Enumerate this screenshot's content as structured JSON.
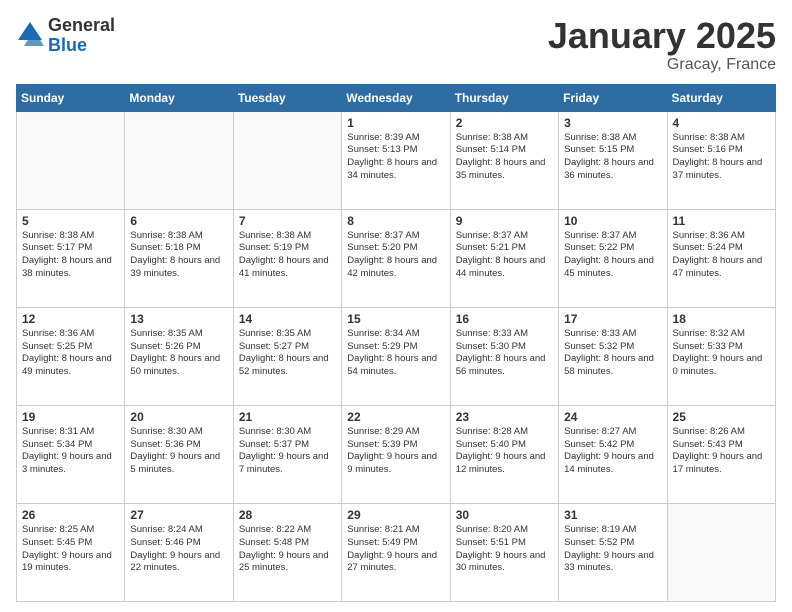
{
  "logo": {
    "general": "General",
    "blue": "Blue"
  },
  "header": {
    "title": "January 2025",
    "subtitle": "Gracay, France"
  },
  "days_of_week": [
    "Sunday",
    "Monday",
    "Tuesday",
    "Wednesday",
    "Thursday",
    "Friday",
    "Saturday"
  ],
  "weeks": [
    [
      {
        "day": "",
        "sunrise": "",
        "sunset": "",
        "daylight": ""
      },
      {
        "day": "",
        "sunrise": "",
        "sunset": "",
        "daylight": ""
      },
      {
        "day": "",
        "sunrise": "",
        "sunset": "",
        "daylight": ""
      },
      {
        "day": "1",
        "sunrise": "Sunrise: 8:39 AM",
        "sunset": "Sunset: 5:13 PM",
        "daylight": "Daylight: 8 hours and 34 minutes."
      },
      {
        "day": "2",
        "sunrise": "Sunrise: 8:38 AM",
        "sunset": "Sunset: 5:14 PM",
        "daylight": "Daylight: 8 hours and 35 minutes."
      },
      {
        "day": "3",
        "sunrise": "Sunrise: 8:38 AM",
        "sunset": "Sunset: 5:15 PM",
        "daylight": "Daylight: 8 hours and 36 minutes."
      },
      {
        "day": "4",
        "sunrise": "Sunrise: 8:38 AM",
        "sunset": "Sunset: 5:16 PM",
        "daylight": "Daylight: 8 hours and 37 minutes."
      }
    ],
    [
      {
        "day": "5",
        "sunrise": "Sunrise: 8:38 AM",
        "sunset": "Sunset: 5:17 PM",
        "daylight": "Daylight: 8 hours and 38 minutes."
      },
      {
        "day": "6",
        "sunrise": "Sunrise: 8:38 AM",
        "sunset": "Sunset: 5:18 PM",
        "daylight": "Daylight: 8 hours and 39 minutes."
      },
      {
        "day": "7",
        "sunrise": "Sunrise: 8:38 AM",
        "sunset": "Sunset: 5:19 PM",
        "daylight": "Daylight: 8 hours and 41 minutes."
      },
      {
        "day": "8",
        "sunrise": "Sunrise: 8:37 AM",
        "sunset": "Sunset: 5:20 PM",
        "daylight": "Daylight: 8 hours and 42 minutes."
      },
      {
        "day": "9",
        "sunrise": "Sunrise: 8:37 AM",
        "sunset": "Sunset: 5:21 PM",
        "daylight": "Daylight: 8 hours and 44 minutes."
      },
      {
        "day": "10",
        "sunrise": "Sunrise: 8:37 AM",
        "sunset": "Sunset: 5:22 PM",
        "daylight": "Daylight: 8 hours and 45 minutes."
      },
      {
        "day": "11",
        "sunrise": "Sunrise: 8:36 AM",
        "sunset": "Sunset: 5:24 PM",
        "daylight": "Daylight: 8 hours and 47 minutes."
      }
    ],
    [
      {
        "day": "12",
        "sunrise": "Sunrise: 8:36 AM",
        "sunset": "Sunset: 5:25 PM",
        "daylight": "Daylight: 8 hours and 49 minutes."
      },
      {
        "day": "13",
        "sunrise": "Sunrise: 8:35 AM",
        "sunset": "Sunset: 5:26 PM",
        "daylight": "Daylight: 8 hours and 50 minutes."
      },
      {
        "day": "14",
        "sunrise": "Sunrise: 8:35 AM",
        "sunset": "Sunset: 5:27 PM",
        "daylight": "Daylight: 8 hours and 52 minutes."
      },
      {
        "day": "15",
        "sunrise": "Sunrise: 8:34 AM",
        "sunset": "Sunset: 5:29 PM",
        "daylight": "Daylight: 8 hours and 54 minutes."
      },
      {
        "day": "16",
        "sunrise": "Sunrise: 8:33 AM",
        "sunset": "Sunset: 5:30 PM",
        "daylight": "Daylight: 8 hours and 56 minutes."
      },
      {
        "day": "17",
        "sunrise": "Sunrise: 8:33 AM",
        "sunset": "Sunset: 5:32 PM",
        "daylight": "Daylight: 8 hours and 58 minutes."
      },
      {
        "day": "18",
        "sunrise": "Sunrise: 8:32 AM",
        "sunset": "Sunset: 5:33 PM",
        "daylight": "Daylight: 9 hours and 0 minutes."
      }
    ],
    [
      {
        "day": "19",
        "sunrise": "Sunrise: 8:31 AM",
        "sunset": "Sunset: 5:34 PM",
        "daylight": "Daylight: 9 hours and 3 minutes."
      },
      {
        "day": "20",
        "sunrise": "Sunrise: 8:30 AM",
        "sunset": "Sunset: 5:36 PM",
        "daylight": "Daylight: 9 hours and 5 minutes."
      },
      {
        "day": "21",
        "sunrise": "Sunrise: 8:30 AM",
        "sunset": "Sunset: 5:37 PM",
        "daylight": "Daylight: 9 hours and 7 minutes."
      },
      {
        "day": "22",
        "sunrise": "Sunrise: 8:29 AM",
        "sunset": "Sunset: 5:39 PM",
        "daylight": "Daylight: 9 hours and 9 minutes."
      },
      {
        "day": "23",
        "sunrise": "Sunrise: 8:28 AM",
        "sunset": "Sunset: 5:40 PM",
        "daylight": "Daylight: 9 hours and 12 minutes."
      },
      {
        "day": "24",
        "sunrise": "Sunrise: 8:27 AM",
        "sunset": "Sunset: 5:42 PM",
        "daylight": "Daylight: 9 hours and 14 minutes."
      },
      {
        "day": "25",
        "sunrise": "Sunrise: 8:26 AM",
        "sunset": "Sunset: 5:43 PM",
        "daylight": "Daylight: 9 hours and 17 minutes."
      }
    ],
    [
      {
        "day": "26",
        "sunrise": "Sunrise: 8:25 AM",
        "sunset": "Sunset: 5:45 PM",
        "daylight": "Daylight: 9 hours and 19 minutes."
      },
      {
        "day": "27",
        "sunrise": "Sunrise: 8:24 AM",
        "sunset": "Sunset: 5:46 PM",
        "daylight": "Daylight: 9 hours and 22 minutes."
      },
      {
        "day": "28",
        "sunrise": "Sunrise: 8:22 AM",
        "sunset": "Sunset: 5:48 PM",
        "daylight": "Daylight: 9 hours and 25 minutes."
      },
      {
        "day": "29",
        "sunrise": "Sunrise: 8:21 AM",
        "sunset": "Sunset: 5:49 PM",
        "daylight": "Daylight: 9 hours and 27 minutes."
      },
      {
        "day": "30",
        "sunrise": "Sunrise: 8:20 AM",
        "sunset": "Sunset: 5:51 PM",
        "daylight": "Daylight: 9 hours and 30 minutes."
      },
      {
        "day": "31",
        "sunrise": "Sunrise: 8:19 AM",
        "sunset": "Sunset: 5:52 PM",
        "daylight": "Daylight: 9 hours and 33 minutes."
      },
      {
        "day": "",
        "sunrise": "",
        "sunset": "",
        "daylight": ""
      }
    ]
  ]
}
